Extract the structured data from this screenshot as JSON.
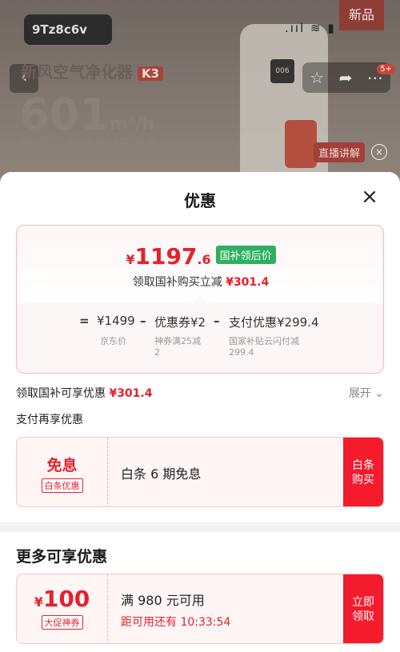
{
  "background": {
    "new_tag": "新品",
    "brand": "9Tz8c6v",
    "status_icons": ".ııl ≋ ▮",
    "product_name": "新风空气净化器",
    "model": "K3",
    "cadr_value": "601",
    "cadr_unit": "m³/h",
    "cadr_note": "甲 醛 CADR值（实测值）",
    "cart_badge": "5+",
    "live_label": "直播讲解"
  },
  "sheet": {
    "title": "优惠",
    "close_label": "×"
  },
  "price_card": {
    "currency": "¥",
    "final_int": "1197",
    "final_dec": ".6",
    "final_tag": "国补领后价",
    "gov_text": "领取国补购买立减",
    "gov_amount": "¥301.4",
    "formula": {
      "eq": "=",
      "jd_price": "¥1499",
      "minus1": "–",
      "coupon": "优惠券¥2",
      "minus2": "–",
      "pay": "支付优惠¥299.4"
    },
    "notes": {
      "jd_price_label": "京东价",
      "coupon_note_1": "神券满25减",
      "coupon_note_2": "2",
      "pay_note_1": "国家补贴云闪付减",
      "pay_note_2": "299.4"
    }
  },
  "gov_row": {
    "label": "领取国补可享优惠",
    "amount": "¥301.4",
    "expand": "展开 ⌄"
  },
  "pay_section": {
    "title": "支付再享优惠"
  },
  "baitiao_coupon": {
    "title": "免息",
    "tag": "白条优惠",
    "desc": "白条 6 期免息",
    "action": "白条购买"
  },
  "more_section": {
    "title": "更多可享优惠"
  },
  "promo_coupon": {
    "currency": "¥",
    "value": "100",
    "tag": "大促神券",
    "condition": "满 980 元可用",
    "countdown": "距可用还有 10:33:54",
    "action": "立即领取"
  },
  "colors": {
    "accent_red": "#e5202e",
    "action_red": "#f41b2c",
    "tag_green": "#2db05f"
  }
}
